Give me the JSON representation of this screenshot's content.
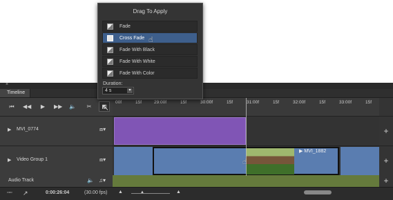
{
  "popup": {
    "title": "Drag To Apply",
    "items": [
      {
        "label": "Fade"
      },
      {
        "label": "Cross Fade"
      },
      {
        "label": "Fade With Black"
      },
      {
        "label": "Fade With White"
      },
      {
        "label": "Fade With Color"
      }
    ],
    "duration_label": "Duration:",
    "duration_value": "4 s"
  },
  "panel": {
    "close": "×",
    "tab": "Timeline",
    "ruler": [
      "00f",
      "15f",
      "29:00f",
      "15f",
      "30:00f",
      "15f",
      "31:00f",
      "15f",
      "32:00f",
      "15f",
      "33:00f",
      "15f"
    ],
    "tracks": [
      {
        "name": "MVI_0774"
      },
      {
        "name": "Video Group 1"
      },
      {
        "name": "Audio Track"
      }
    ],
    "clip_label": "MVI_1882",
    "timecode": "0:00:26:04",
    "fps": "(30.00 fps)"
  },
  "colors": {
    "purple_clip": "#8055b5",
    "blue_clip": "#5a7db0",
    "audio": "#657a3c",
    "selected_item": "#3e5f8c"
  }
}
